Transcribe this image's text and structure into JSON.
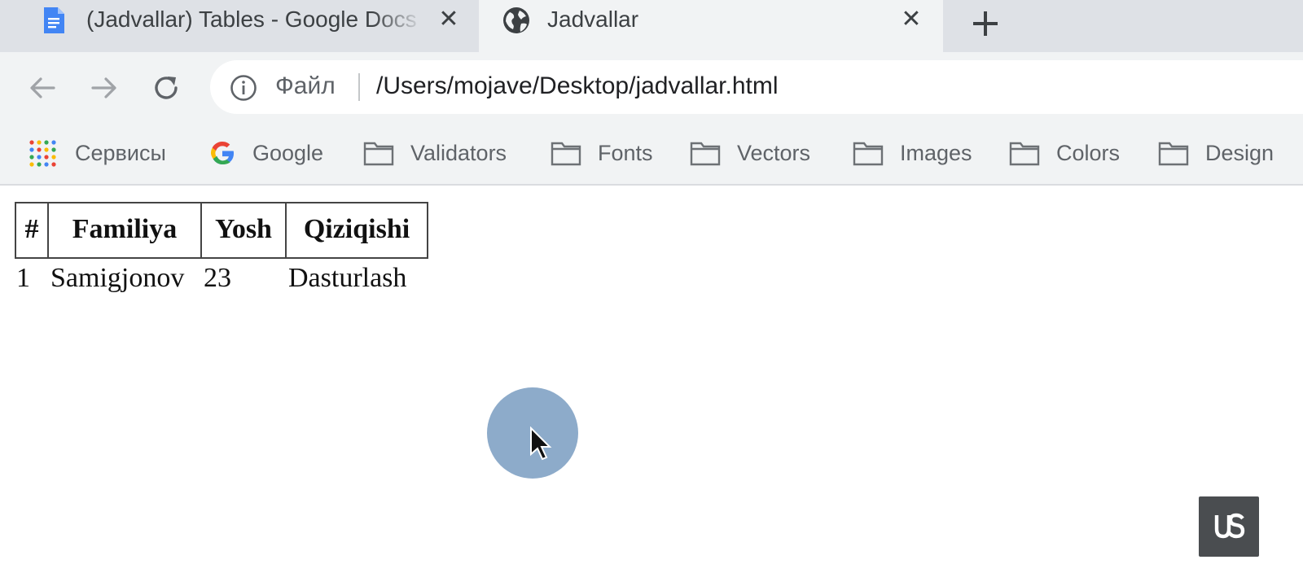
{
  "tabs": [
    {
      "title": "(Jadvallar) Tables - Google Docs",
      "icon": "google-docs-icon",
      "active": false
    },
    {
      "title": "Jadvallar",
      "icon": "globe-icon",
      "active": true
    }
  ],
  "toolbar": {
    "scheme_label": "Файл",
    "url": "/Users/mojave/Desktop/jadvallar.html"
  },
  "bookmarks": [
    {
      "label": "Сервисы",
      "icon": "apps-grid-icon"
    },
    {
      "label": "Google",
      "icon": "google-g-icon"
    },
    {
      "label": "Validators",
      "icon": "folder-icon"
    },
    {
      "label": "Fonts",
      "icon": "folder-icon"
    },
    {
      "label": "Vectors",
      "icon": "folder-icon"
    },
    {
      "label": "Images",
      "icon": "folder-icon"
    },
    {
      "label": "Colors",
      "icon": "folder-icon"
    },
    {
      "label": "Design",
      "icon": "folder-icon"
    }
  ],
  "table": {
    "headers": [
      "#",
      "Familiya",
      "Yosh",
      "Qiziqishi"
    ],
    "rows": [
      [
        "1",
        "Samigjonov",
        "23",
        "Dasturlash"
      ]
    ]
  },
  "colors": {
    "tabstrip": "#dee1e6",
    "toolbar": "#f1f3f4",
    "cursor_halo": "#7498be",
    "badge": "#4a4d50"
  }
}
